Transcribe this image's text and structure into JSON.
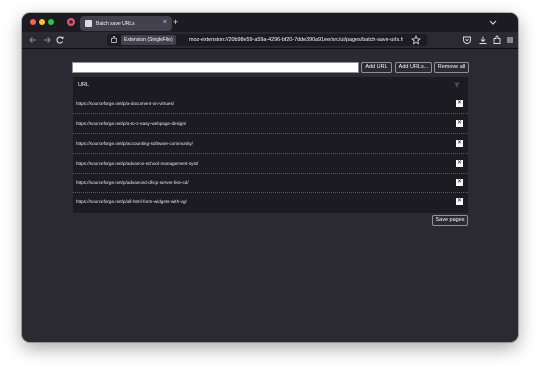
{
  "browser": {
    "tab_title": "Batch save URLs",
    "extension_label": "Extension (SingleFile)",
    "url": "moz-extension://20b98e59-a59a-4296-bf20-7dde390a91ee/src/ui/pages/batch-save-urls.html"
  },
  "page": {
    "url_input": {
      "value": "",
      "placeholder": ""
    },
    "buttons": {
      "add_url": "Add URL",
      "add_urls": "Add URLs...",
      "remove_all": "Remove all",
      "save_pages": "Save pages"
    },
    "table": {
      "header": "URL",
      "rows": [
        {
          "url": "https://sourceforge.net/p/a-document-on-virtues/",
          "remove": "✕"
        },
        {
          "url": "https://sourceforge.net/p/a-to-z-easy-webpage-design/",
          "remove": "✕"
        },
        {
          "url": "https://sourceforge.net/p/accounting-software-community/",
          "remove": "✕"
        },
        {
          "url": "https://sourceforge.net/p/advance-school-management-syst/",
          "remove": "✕"
        },
        {
          "url": "https://sourceforge.net/p/advanced-dhcp-server-live-cd/",
          "remove": "✕"
        },
        {
          "url": "https://sourceforge.net/p/all-html-form-widgets-with-vg/",
          "remove": "✕"
        }
      ]
    }
  }
}
